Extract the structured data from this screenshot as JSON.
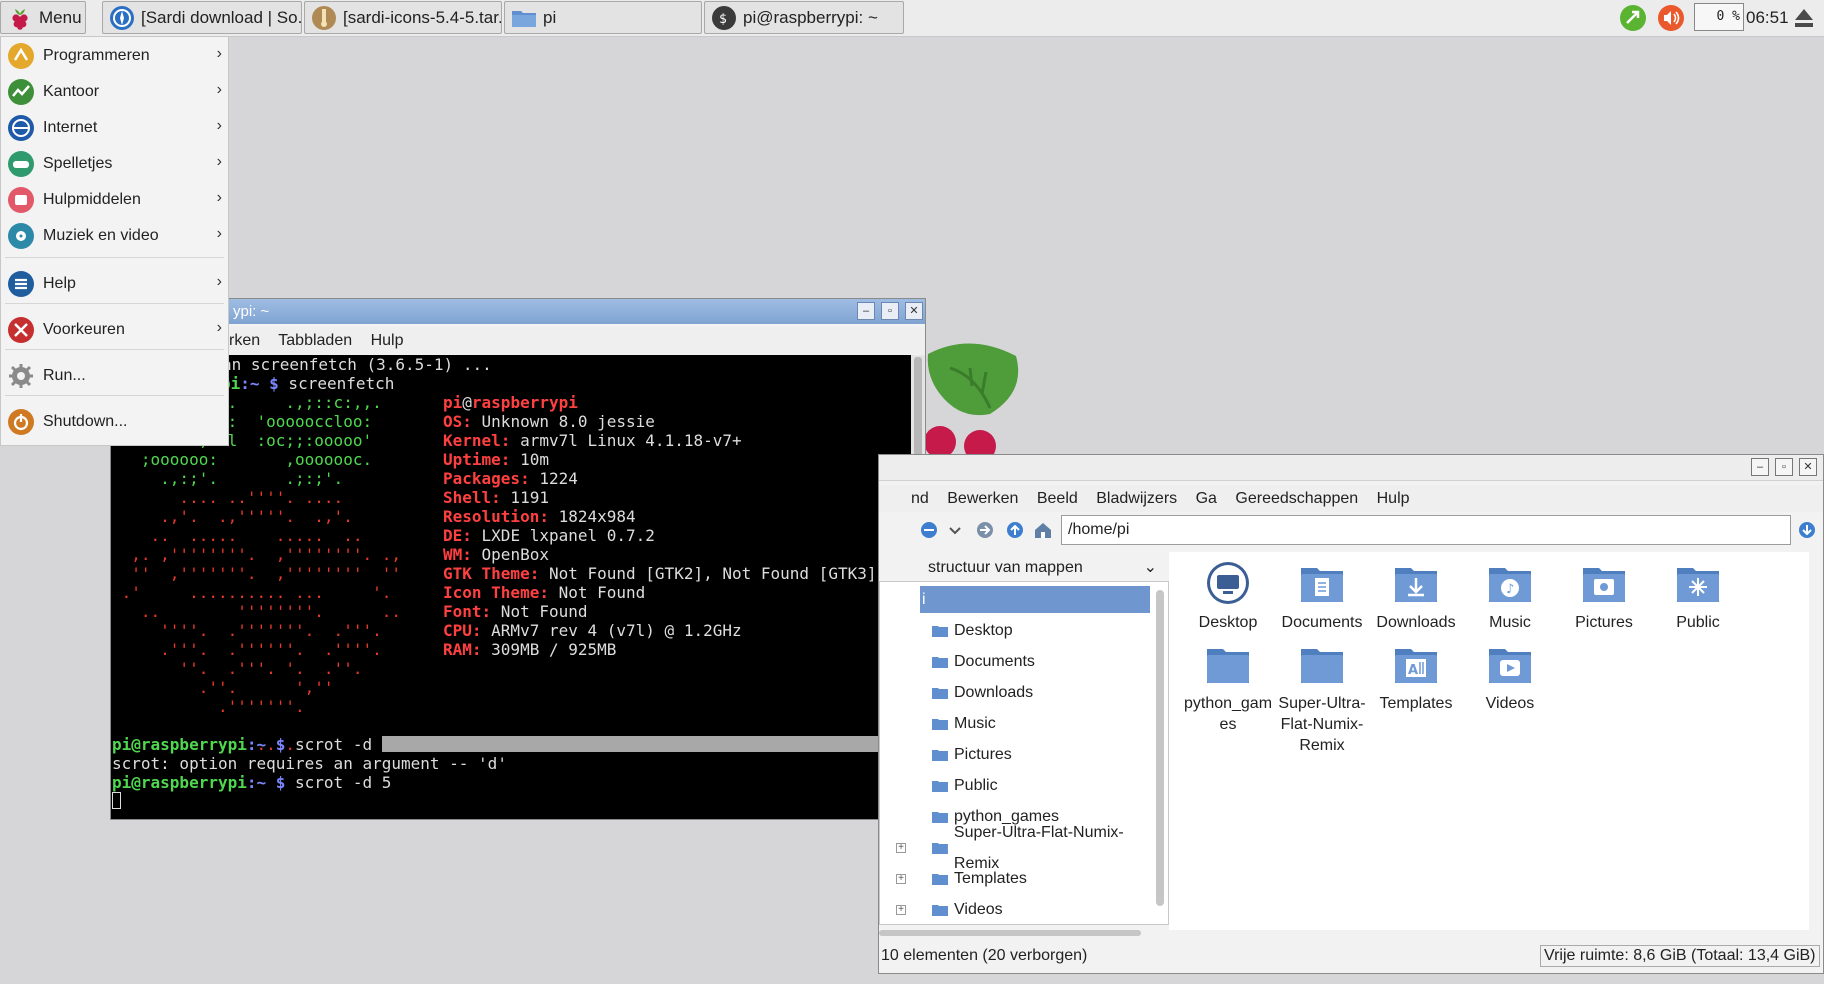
{
  "taskbar": {
    "menu_label": "Menu",
    "tasks": [
      "[Sardi download | So...",
      "[sardi-icons-5.4-5.tar....",
      "pi",
      "pi@raspberrypi: ~"
    ],
    "cpu": "0 %",
    "clock": "06:51"
  },
  "app_menu": {
    "items": [
      {
        "label": "Programmeren",
        "icon": "programming-icon"
      },
      {
        "label": "Kantoor",
        "icon": "office-icon"
      },
      {
        "label": "Internet",
        "icon": "internet-icon"
      },
      {
        "label": "Spelletjes",
        "icon": "games-icon"
      },
      {
        "label": "Hulpmiddelen",
        "icon": "accessories-icon"
      },
      {
        "label": "Muziek en video",
        "icon": "multimedia-icon"
      },
      {
        "label": "Help",
        "icon": "help-icon"
      },
      {
        "label": "Voorkeuren",
        "icon": "preferences-icon"
      },
      {
        "label": "Run...",
        "icon": "run-gear-icon"
      },
      {
        "label": "Shutdown...",
        "icon": "shutdown-icon"
      }
    ],
    "arrow": "›"
  },
  "terminal": {
    "title": "pi@raspberrypi: ~",
    "title_visible": "ypi: ~",
    "menu": [
      "rken",
      "Tabbladen",
      "Hulp"
    ],
    "lines": {
      "l0": "an screenfetch (3.6.5-1) ...",
      "l1_prompt_tail": "pi",
      "l1_path": ":~ $",
      "l1_cmd": " screenfetch",
      "user_host_user": "pi",
      "user_host_at": "@",
      "user_host_host": "raspberrypi",
      "info": [
        {
          "k": "OS:",
          "v": " Unknown 8.0 jessie"
        },
        {
          "k": "Kernel:",
          "v": " armv7l Linux 4.1.18-v7+"
        },
        {
          "k": "Uptime:",
          "v": " 10m"
        },
        {
          "k": "Packages:",
          "v": " 1224"
        },
        {
          "k": "Shell:",
          "v": " 1191"
        },
        {
          "k": "Resolution:",
          "v": " 1824x984"
        },
        {
          "k": "DE:",
          "v": " LXDE lxpanel 0.7.2"
        },
        {
          "k": "WM:",
          "v": " OpenBox"
        },
        {
          "k": "GTK Theme:",
          "v": " Not Found [GTK2], Not Found [GTK3]"
        },
        {
          "k": "Icon Theme:",
          "v": " Not Found"
        },
        {
          "k": "Font:",
          "v": " Not Found"
        },
        {
          "k": "CPU:",
          "v": " ARMv7 rev 4 (v7l) @ 1.2GHz"
        },
        {
          "k": "RAM:",
          "v": " 309MB / 925MB"
        }
      ],
      "ascii_green": [
        "          ,'.     .,;::c:,,.",
        "         ooo:  'oooooccloo:",
        "         ;:ol  :oc;;:ooooo'",
        "   ;oooooo:       ,ooooooc.",
        "     .,:;'.       .;:;'."
      ],
      "ascii_red": [
        "       .... ..''''. ....",
        "     .,'.  .,'''''.  .,'.",
        "    ..  .....    .....  ..",
        "  ,. ,''''''''.  ,''''''''. .,",
        "  ''  ,'''''''.  ,''''''''  ''",
        " .'     .......... ...     '.",
        "   ..        ''''''''.      ..",
        "     ''''.  .'''''''.  .'''.",
        "     .'''.  .''''''.  .''''.",
        "       ''.  .'''. '.  .''.",
        "         .''.      ',''",
        "           .'''''''.",
        "",
        "             ......"
      ],
      "p_user": "pi@raspberrypi",
      "p_path": ":~ $",
      "cmd1": " scrot -d ",
      "err": "scrot: option requires an argument -- 'd'",
      "cmd2": " scrot -d 5"
    }
  },
  "file_manager": {
    "menu": [
      "nd",
      "Bewerken",
      "Beeld",
      "Bladwijzers",
      "Ga",
      "Gereedschappen",
      "Hulp"
    ],
    "path": "/home/pi",
    "side_header": "structuur van mappen",
    "tree_selected": "i",
    "tree": [
      "Desktop",
      "Documents",
      "Downloads",
      "Music",
      "Pictures",
      "Public",
      "python_games",
      "Super-Ultra-Flat-Numix-Remix",
      "Templates",
      "Videos"
    ],
    "expanders": "+",
    "files": [
      {
        "name": "Desktop",
        "icon": "desktop-folder-icon"
      },
      {
        "name": "Documents",
        "icon": "documents-folder-icon"
      },
      {
        "name": "Downloads",
        "icon": "downloads-folder-icon"
      },
      {
        "name": "Music",
        "icon": "music-folder-icon"
      },
      {
        "name": "Pictures",
        "icon": "pictures-folder-icon"
      },
      {
        "name": "Public",
        "icon": "public-folder-icon"
      },
      {
        "name": "python_games",
        "icon": "folder-icon"
      },
      {
        "name": "Super-Ultra-Flat-Numix-Remix",
        "icon": "folder-icon"
      },
      {
        "name": "Templates",
        "icon": "templates-folder-icon"
      },
      {
        "name": "Videos",
        "icon": "videos-folder-icon"
      }
    ],
    "status_left": "10 elementen (20 verborgen)",
    "status_right": "Vrije ruimte: 8,6 GiB (Totaal: 13,4 GiB)"
  },
  "colors": {
    "desktop": "#d6d6d9",
    "terminal_bg": "#000000",
    "prompt_green": "#4fd84f",
    "prompt_blue": "#7b87ff",
    "info_red": "#ff4040",
    "selection_blue": "#6f96cf",
    "folder_blue": "#5f8fcf"
  }
}
